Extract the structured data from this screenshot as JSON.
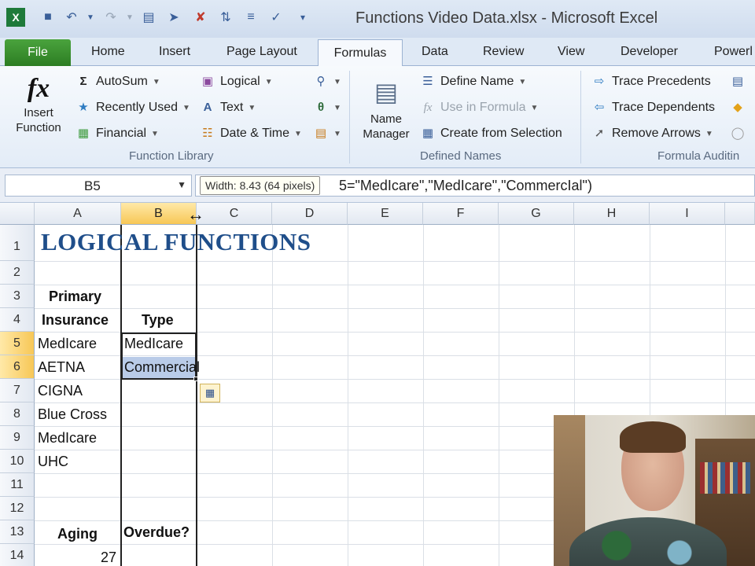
{
  "titlebar": {
    "title": "Functions Video Data.xlsx - Microsoft Excel",
    "qat_icons": [
      "excel-logo-icon",
      "save-icon",
      "undo-icon",
      "redo-icon",
      "quick-access-icon-1",
      "quick-access-icon-2",
      "quick-access-icon-3",
      "quick-access-icon-4",
      "quick-access-icon-5",
      "quick-access-icon-6",
      "customize-qat-icon"
    ]
  },
  "tabs": {
    "file": "File",
    "home": "Home",
    "insert": "Insert",
    "page_layout": "Page Layout",
    "formulas": "Formulas",
    "data": "Data",
    "review": "Review",
    "view": "View",
    "developer": "Developer",
    "power": "Powerl"
  },
  "ribbon": {
    "insert_function_line1": "Insert",
    "insert_function_line2": "Function",
    "autosum": "AutoSum",
    "recently_used": "Recently Used",
    "financial": "Financial",
    "logical": "Logical",
    "text": "Text",
    "date_time": "Date & Time",
    "function_library_label": "Function Library",
    "name_manager_line1": "Name",
    "name_manager_line2": "Manager",
    "define_name": "Define Name",
    "use_in_formula": "Use in Formula",
    "create_from_selection": "Create from Selection",
    "defined_names_label": "Defined Names",
    "trace_precedents": "Trace Precedents",
    "trace_dependents": "Trace Dependents",
    "remove_arrows": "Remove Arrows",
    "formula_auditing_label": "Formula Auditin"
  },
  "formula_bar": {
    "name_box": "B5",
    "formula_visible": "5=\"MedIcare\",\"MedIcare\",\"CommercIal\")",
    "tooltip": "Width: 8.43 (64 pixels)"
  },
  "grid": {
    "columns": [
      "A",
      "B",
      "C",
      "D",
      "E",
      "F",
      "G",
      "H",
      "I"
    ],
    "rows": [
      "1",
      "2",
      "3",
      "4",
      "5",
      "6",
      "7",
      "8",
      "9",
      "10",
      "11",
      "12",
      "13",
      "14"
    ],
    "title": "LOGICAL FUNCTIONS",
    "a3": "Primary",
    "a4": "Insurance",
    "b4": "Type",
    "a5": "MedIcare",
    "b5": "MedIcare",
    "a6": "AETNA",
    "b6": "Commercial",
    "a7": "CIGNA",
    "a8": "Blue Cross",
    "a9": "MedIcare",
    "a10": "UHC",
    "a13": "Aging",
    "b13": "Overdue?",
    "a14": "27"
  }
}
